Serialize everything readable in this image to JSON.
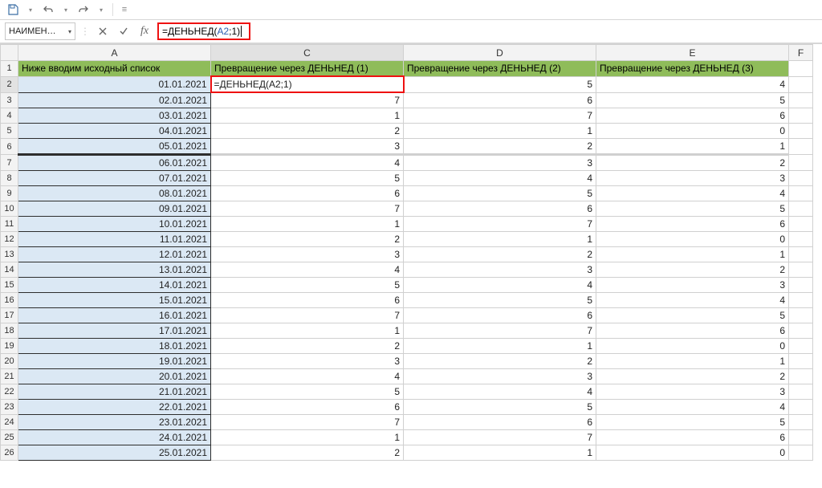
{
  "qat": {
    "save_title": "save-icon",
    "undo_title": "undo-icon",
    "redo_title": "redo-icon"
  },
  "name_box": {
    "value": "НАИМЕН…"
  },
  "formula": {
    "prefix": "=ДЕНЬНЕД(",
    "arg_ref": "A2",
    "suffix": ";1)"
  },
  "columns": {
    "A": "A",
    "C": "C",
    "D": "D",
    "E": "E",
    "F": "F"
  },
  "headers": {
    "A": "Ниже вводим исходный список",
    "C": "Превращение через ДЕНЬНЕД (1)",
    "D": "Превращение через ДЕНЬНЕД (2)",
    "E": "Превращение через ДЕНЬНЕД (3)"
  },
  "editing_cell_text": "=ДЕНЬНЕД(A2;1)",
  "chart_data": {
    "type": "table",
    "columns": [
      "row",
      "A",
      "C",
      "D",
      "E"
    ],
    "rows": [
      {
        "row": 2,
        "A": "01.01.2021",
        "C": "=ДЕНЬНЕД(A2;1)",
        "D": 5,
        "E": 4
      },
      {
        "row": 3,
        "A": "02.01.2021",
        "C": 7,
        "D": 6,
        "E": 5
      },
      {
        "row": 4,
        "A": "03.01.2021",
        "C": 1,
        "D": 7,
        "E": 6
      },
      {
        "row": 5,
        "A": "04.01.2021",
        "C": 2,
        "D": 1,
        "E": 0
      },
      {
        "row": 6,
        "A": "05.01.2021",
        "C": 3,
        "D": 2,
        "E": 1
      },
      {
        "row": 7,
        "A": "06.01.2021",
        "C": 4,
        "D": 3,
        "E": 2
      },
      {
        "row": 8,
        "A": "07.01.2021",
        "C": 5,
        "D": 4,
        "E": 3
      },
      {
        "row": 9,
        "A": "08.01.2021",
        "C": 6,
        "D": 5,
        "E": 4
      },
      {
        "row": 10,
        "A": "09.01.2021",
        "C": 7,
        "D": 6,
        "E": 5
      },
      {
        "row": 11,
        "A": "10.01.2021",
        "C": 1,
        "D": 7,
        "E": 6
      },
      {
        "row": 12,
        "A": "11.01.2021",
        "C": 2,
        "D": 1,
        "E": 0
      },
      {
        "row": 13,
        "A": "12.01.2021",
        "C": 3,
        "D": 2,
        "E": 1
      },
      {
        "row": 14,
        "A": "13.01.2021",
        "C": 4,
        "D": 3,
        "E": 2
      },
      {
        "row": 15,
        "A": "14.01.2021",
        "C": 5,
        "D": 4,
        "E": 3
      },
      {
        "row": 16,
        "A": "15.01.2021",
        "C": 6,
        "D": 5,
        "E": 4
      },
      {
        "row": 17,
        "A": "16.01.2021",
        "C": 7,
        "D": 6,
        "E": 5
      },
      {
        "row": 18,
        "A": "17.01.2021",
        "C": 1,
        "D": 7,
        "E": 6
      },
      {
        "row": 19,
        "A": "18.01.2021",
        "C": 2,
        "D": 1,
        "E": 0
      },
      {
        "row": 20,
        "A": "19.01.2021",
        "C": 3,
        "D": 2,
        "E": 1
      },
      {
        "row": 21,
        "A": "20.01.2021",
        "C": 4,
        "D": 3,
        "E": 2
      },
      {
        "row": 22,
        "A": "21.01.2021",
        "C": 5,
        "D": 4,
        "E": 3
      },
      {
        "row": 23,
        "A": "22.01.2021",
        "C": 6,
        "D": 5,
        "E": 4
      },
      {
        "row": 24,
        "A": "23.01.2021",
        "C": 7,
        "D": 6,
        "E": 5
      },
      {
        "row": 25,
        "A": "24.01.2021",
        "C": 1,
        "D": 7,
        "E": 6
      },
      {
        "row": 26,
        "A": "25.01.2021",
        "C": 2,
        "D": 1,
        "E": 0
      }
    ],
    "blank_after_row": 6
  }
}
